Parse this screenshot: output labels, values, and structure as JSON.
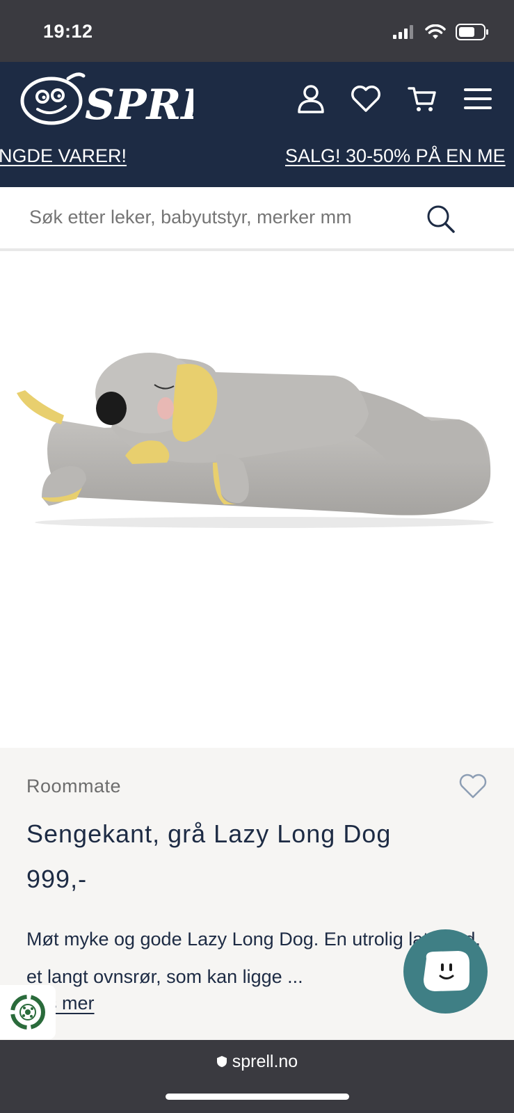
{
  "status": {
    "time": "19:12"
  },
  "header": {
    "brand": "SPRELL",
    "ticker": [
      "NGDE VARER!",
      "SALG! 30-50% PÅ EN ME"
    ]
  },
  "search": {
    "placeholder": "Søk etter leker, babyutstyr, merker mm"
  },
  "product": {
    "brand": "Roommate",
    "title": "Sengekant, grå Lazy Long Dog",
    "price": "999,-",
    "description": "Møt myke og gode Lazy Long Dog. En utrolig lat hund, et langt ovnsrør, som kan ligge ...",
    "read_more": "Les mer"
  },
  "browser": {
    "url": "sprell.no"
  },
  "colors": {
    "header_bg": "#1d2b44",
    "chat_bg": "#3f7f85",
    "panel_bg": "#f6f5f3"
  }
}
